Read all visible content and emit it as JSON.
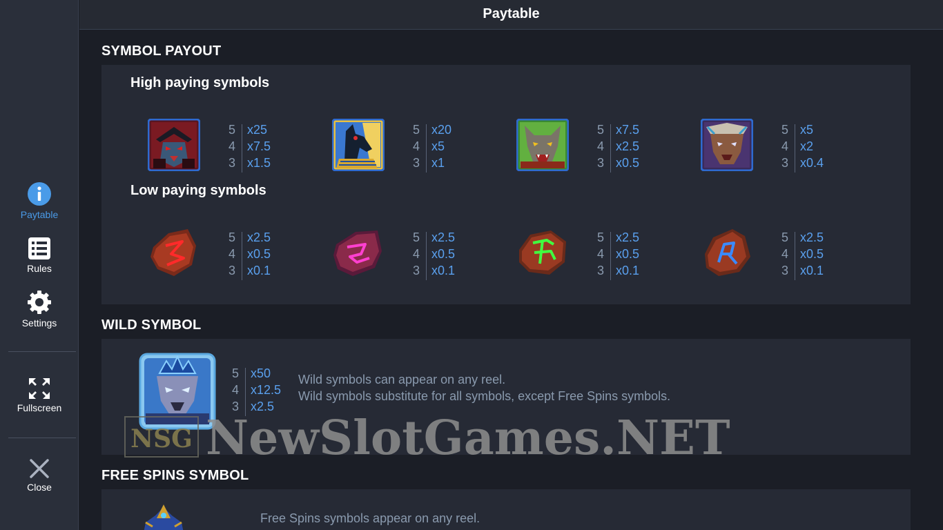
{
  "window_title": "Paytable",
  "sidebar": {
    "items": [
      {
        "label": "Paytable",
        "icon": "info-icon",
        "active": true
      },
      {
        "label": "Rules",
        "icon": "list-icon"
      },
      {
        "label": "Settings",
        "icon": "gear-icon"
      },
      {
        "label": "Fullscreen",
        "icon": "fullscreen-icon"
      },
      {
        "label": "Close",
        "icon": "close-icon"
      }
    ]
  },
  "symbol_payout": {
    "title": "SYMBOL PAYOUT",
    "high_label": "High paying symbols",
    "high": [
      {
        "name": "samurai-wolf-symbol",
        "counts": [
          "5",
          "4",
          "3"
        ],
        "mults": [
          "x25",
          "x7.5",
          "x1.5"
        ]
      },
      {
        "name": "anubis-symbol",
        "counts": [
          "5",
          "4",
          "3"
        ],
        "mults": [
          "x20",
          "x5",
          "x1"
        ]
      },
      {
        "name": "gray-wolf-symbol",
        "counts": [
          "5",
          "4",
          "3"
        ],
        "mults": [
          "x7.5",
          "x2.5",
          "x0.5"
        ]
      },
      {
        "name": "tribal-wolf-symbol",
        "counts": [
          "5",
          "4",
          "3"
        ],
        "mults": [
          "x5",
          "x2",
          "x0.4"
        ]
      }
    ],
    "low_label": "Low paying symbols",
    "low": [
      {
        "name": "red-rune-symbol",
        "counts": [
          "5",
          "4",
          "3"
        ],
        "mults": [
          "x2.5",
          "x0.5",
          "x0.1"
        ]
      },
      {
        "name": "pink-rune-symbol",
        "counts": [
          "5",
          "4",
          "3"
        ],
        "mults": [
          "x2.5",
          "x0.5",
          "x0.1"
        ]
      },
      {
        "name": "green-rune-symbol",
        "counts": [
          "5",
          "4",
          "3"
        ],
        "mults": [
          "x2.5",
          "x0.5",
          "x0.1"
        ]
      },
      {
        "name": "blue-rune-symbol",
        "counts": [
          "5",
          "4",
          "3"
        ],
        "mults": [
          "x2.5",
          "x0.5",
          "x0.1"
        ]
      }
    ]
  },
  "wild": {
    "title": "WILD SYMBOL",
    "counts": [
      "5",
      "4",
      "3"
    ],
    "mults": [
      "x50",
      "x12.5",
      "x2.5"
    ],
    "desc1": "Wild symbols can appear on any reel.",
    "desc2": "Wild symbols substitute for all symbols, except Free Spins symbols."
  },
  "free_spins": {
    "title": "FREE SPINS SYMBOL",
    "desc1": "Free Spins symbols appear on any reel."
  },
  "watermark": {
    "logo": "NSG",
    "text": "NewSlotGames.NET"
  },
  "colors": {
    "accent": "#4a9be8",
    "multiplier": "#5aa0ee",
    "muted": "#8a9aae",
    "panel": "#262a35"
  }
}
